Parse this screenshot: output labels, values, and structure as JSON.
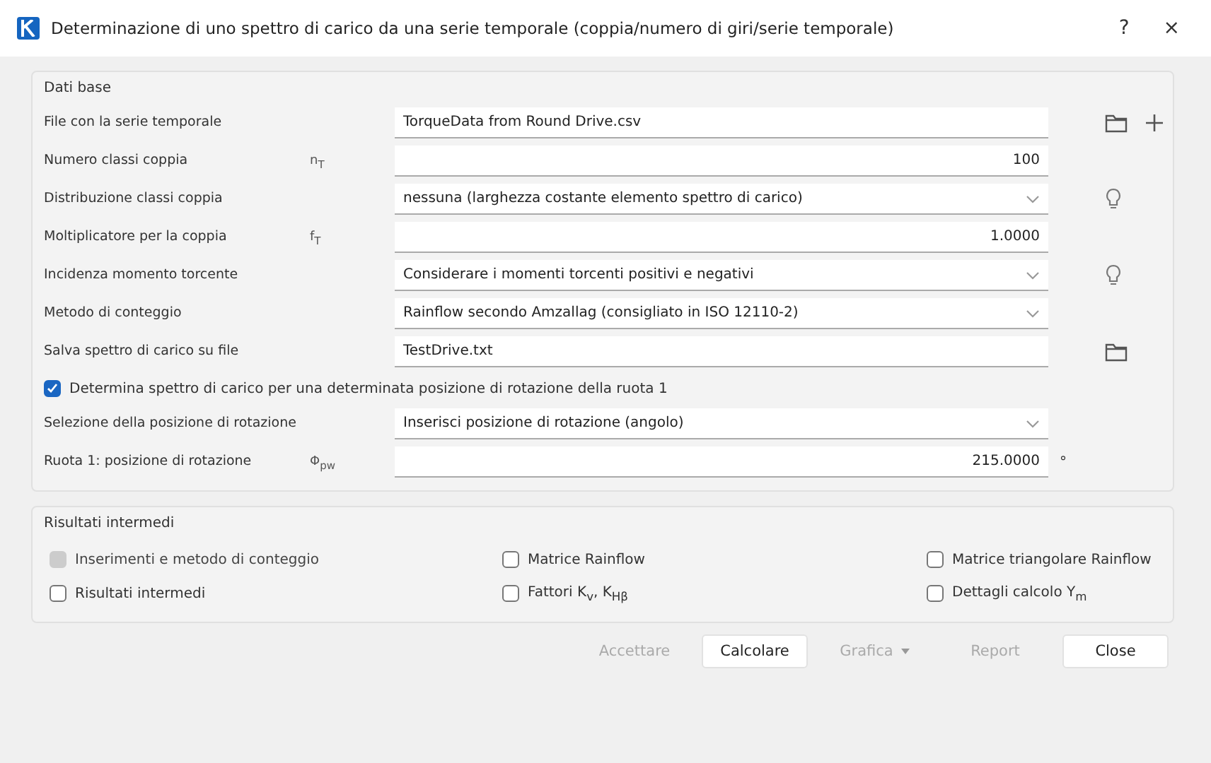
{
  "window": {
    "title": "Determinazione di uno spettro di carico da una serie temporale (coppia/numero di giri/serie temporale)",
    "help": "?",
    "close": "×"
  },
  "basic": {
    "title": "Dati base",
    "rows": [
      {
        "kind": "text",
        "label": "File con la serie temporale",
        "value": "TorqueData from Round Drive.csv",
        "actions": [
          {
            "kind": "folder"
          },
          {
            "kind": "plus"
          }
        ]
      },
      {
        "kind": "number",
        "label": "Numero classi coppia",
        "symbol": "n$_{T}$",
        "value": "100"
      },
      {
        "kind": "select",
        "label": "Distribuzione classi coppia",
        "value": "nessuna (larghezza costante elemento spettro di carico)",
        "actions": [
          {
            "kind": "bulb"
          }
        ]
      },
      {
        "kind": "number",
        "label": "Moltiplicatore per la coppia",
        "symbol": "f$_{T}$",
        "value": "1.0000"
      },
      {
        "kind": "select",
        "label": "Incidenza momento torcente",
        "value": "Considerare i momenti torcenti positivi e negativi",
        "actions": [
          {
            "kind": "bulb"
          }
        ]
      },
      {
        "kind": "select",
        "label": "Metodo di conteggio",
        "value": "Rainflow secondo Amzallag (consigliato in ISO 12110-2)"
      },
      {
        "kind": "text",
        "label": "Salva spettro di carico su file",
        "value": "TestDrive.txt",
        "actions": [
          {
            "kind": "folder"
          }
        ]
      },
      {
        "kind": "checkbox",
        "label": "Determina spettro di carico per una determinata posizione di rotazione della ruota 1",
        "checked": true
      },
      {
        "kind": "select",
        "label": "Selezione della posizione di rotazione",
        "value": "Inserisci posizione di rotazione (angolo)"
      },
      {
        "kind": "number",
        "label": "Ruota 1: posizione di rotazione",
        "symbol": "Φ$_{pw}$",
        "value": "215.0000",
        "unit": "°"
      }
    ]
  },
  "intermediate": {
    "title": "Risultati intermedi",
    "options": [
      {
        "label": "Inserimenti e metodo di conteggio",
        "checked": false,
        "disabled": true
      },
      {
        "label": "Matrice Rainflow",
        "checked": false,
        "disabled": false
      },
      {
        "label": "Matrice triangolare Rainflow",
        "checked": false,
        "disabled": false
      },
      {
        "label": "Risultati intermedi",
        "checked": false,
        "disabled": false
      },
      {
        "label": "Fattori K$_{v}$, K$_{Hβ}$",
        "checked": false,
        "disabled": false
      },
      {
        "label": "Dettagli calcolo Y$_{m}$",
        "checked": false,
        "disabled": false
      }
    ]
  },
  "buttons": [
    {
      "label": "Accettare",
      "disabled": true,
      "dropdown": false
    },
    {
      "label": "Calcolare",
      "disabled": false,
      "dropdown": false
    },
    {
      "label": "Grafica",
      "disabled": true,
      "dropdown": true
    },
    {
      "label": "Report",
      "disabled": true,
      "dropdown": false
    },
    {
      "label": "Close",
      "disabled": false,
      "dropdown": false
    }
  ]
}
